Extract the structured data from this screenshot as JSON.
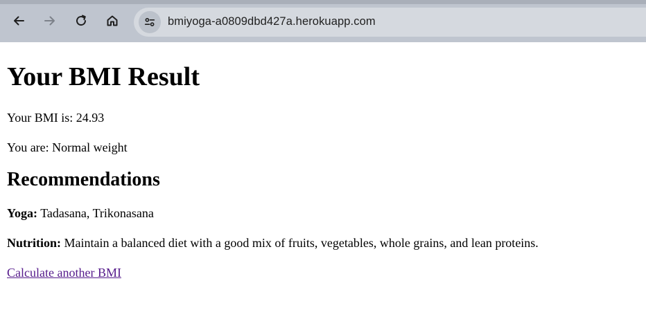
{
  "browser": {
    "url": "bmiyoga-a0809dbd427a.herokuapp.com",
    "icons": [
      "back-arrow-icon",
      "forward-arrow-icon",
      "reload-icon",
      "home-icon",
      "site-info-icon"
    ]
  },
  "page": {
    "title": "Your BMI Result",
    "bmi_label": "Your BMI is:",
    "bmi_value": "24.93",
    "category_label": "You are:",
    "category_value": "Normal weight",
    "recommendations_heading": "Recommendations",
    "yoga_label": "Yoga:",
    "yoga_value": "Tadasana, Trikonasana",
    "nutrition_label": "Nutrition:",
    "nutrition_value": "Maintain a balanced diet with a good mix of fruits, vegetables, whole grains, and lean proteins.",
    "calculate_link": "Calculate another BMI"
  }
}
